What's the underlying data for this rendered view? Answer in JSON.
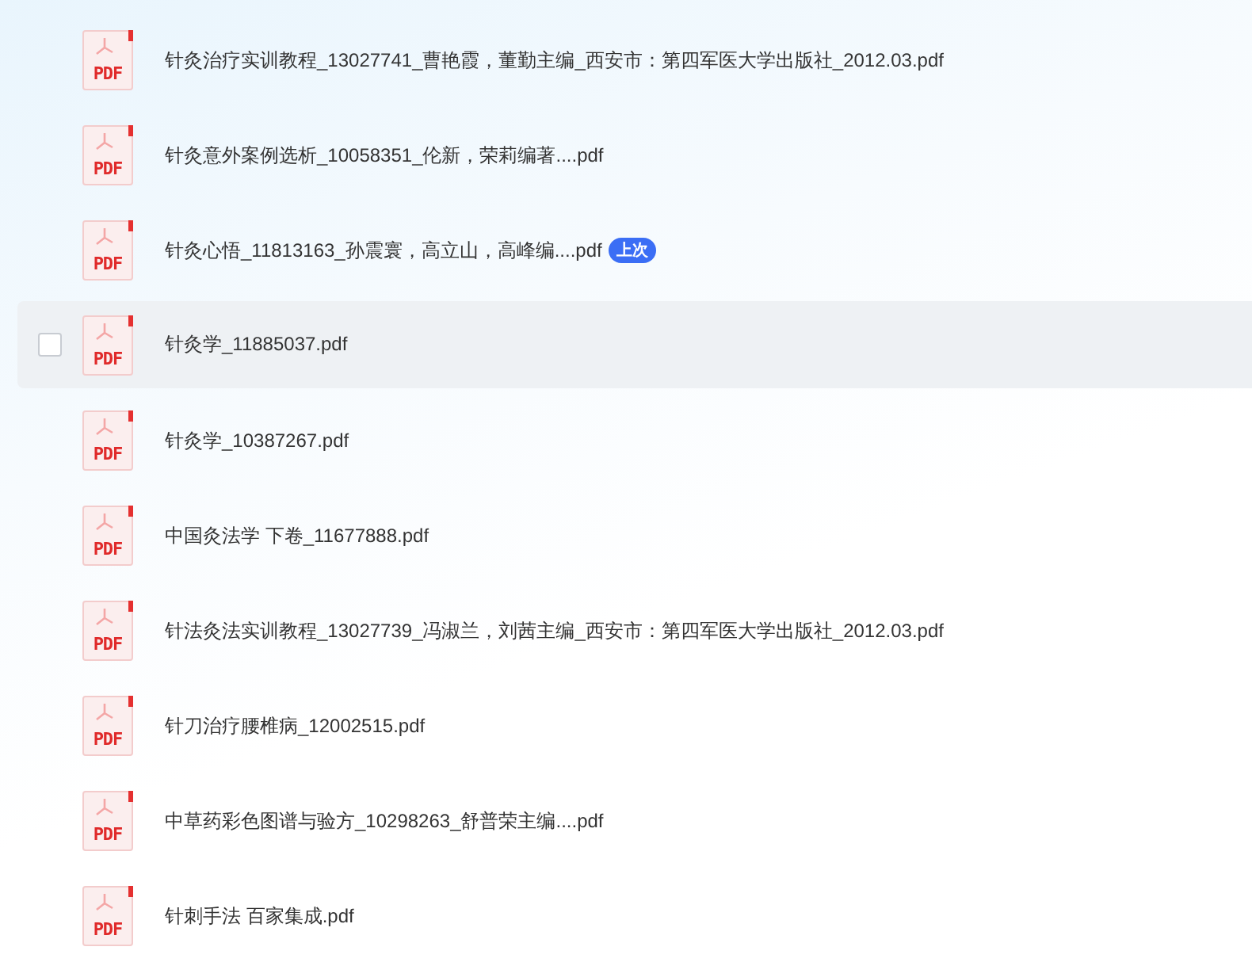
{
  "files": [
    {
      "name": "针灸治疗实训教程_13027741_曹艳霞，董勤主编_西安市：第四军医大学出版社_2012.03.pdf",
      "icon_label": "PDF",
      "hovered": false,
      "checked": false
    },
    {
      "name": "针灸意外案例选析_10058351_伦新，荣莉编著....pdf",
      "icon_label": "PDF",
      "hovered": false,
      "checked": false
    },
    {
      "name": "针灸心悟_11813163_孙震寰，高立山，高峰编....pdf",
      "icon_label": "PDF",
      "badge": "上次",
      "hovered": false,
      "checked": false
    },
    {
      "name": "针灸学_11885037.pdf",
      "icon_label": "PDF",
      "hovered": true,
      "checked": false
    },
    {
      "name": "针灸学_10387267.pdf",
      "icon_label": "PDF",
      "hovered": false,
      "checked": false
    },
    {
      "name": "中国灸法学  下卷_11677888.pdf",
      "icon_label": "PDF",
      "hovered": false,
      "checked": false
    },
    {
      "name": "针法灸法实训教程_13027739_冯淑兰，刘茜主编_西安市：第四军医大学出版社_2012.03.pdf",
      "icon_label": "PDF",
      "hovered": false,
      "checked": false
    },
    {
      "name": "针刀治疗腰椎病_12002515.pdf",
      "icon_label": "PDF",
      "hovered": false,
      "checked": false
    },
    {
      "name": "中草药彩色图谱与验方_10298263_舒普荣主编....pdf",
      "icon_label": "PDF",
      "hovered": false,
      "checked": false
    },
    {
      "name": "针刺手法 百家集成.pdf",
      "icon_label": "PDF",
      "hovered": false,
      "checked": false
    }
  ]
}
